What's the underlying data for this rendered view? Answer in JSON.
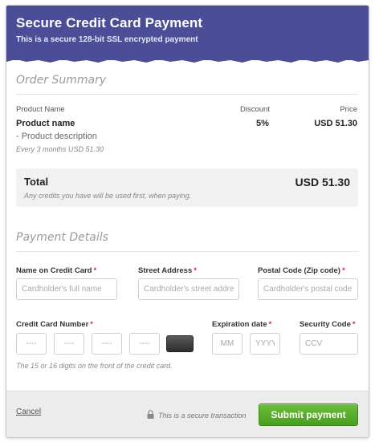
{
  "header": {
    "title": "Secure Credit Card Payment",
    "subtitle": "This is a secure 128-bit SSL encrypted payment",
    "color": "#4b4e96"
  },
  "order_summary": {
    "title": "Order Summary",
    "columns": {
      "product": "Product Name",
      "discount": "Discount",
      "price": "Price"
    },
    "product": {
      "name": "Product name",
      "description": "- Product description",
      "recurrence": "Every 3 months USD 51.30",
      "discount": "5%",
      "price": "USD 51.30"
    },
    "total": {
      "label": "Total",
      "value": "USD 51.30",
      "note": "Any credits you have will be used first, when paying."
    }
  },
  "payment_details": {
    "title": "Payment Details",
    "name_label": "Name on Credit Card",
    "name_placeholder": "Cardholder's full name",
    "address_label": "Street Address",
    "address_placeholder": "Cardholder's street address",
    "postal_label": "Postal Code (Zip code)",
    "postal_placeholder": "Cardholder's postal code",
    "card_label": "Credit Card Number",
    "card_segment_placeholder": "----",
    "expiry_label": "Expiration date",
    "month_placeholder": "MM",
    "year_placeholder": "YYYY",
    "cvc_label": "Security Code",
    "cvc_placeholder": "CCV",
    "required_mark": "*",
    "hint": "The 15 or 16 digits on the front of the credit card."
  },
  "footer": {
    "cancel_label": "Cancel",
    "secure_text": "This is a secure transaction",
    "submit_label": "Submit payment",
    "submit_color": "#5aaf2c"
  }
}
